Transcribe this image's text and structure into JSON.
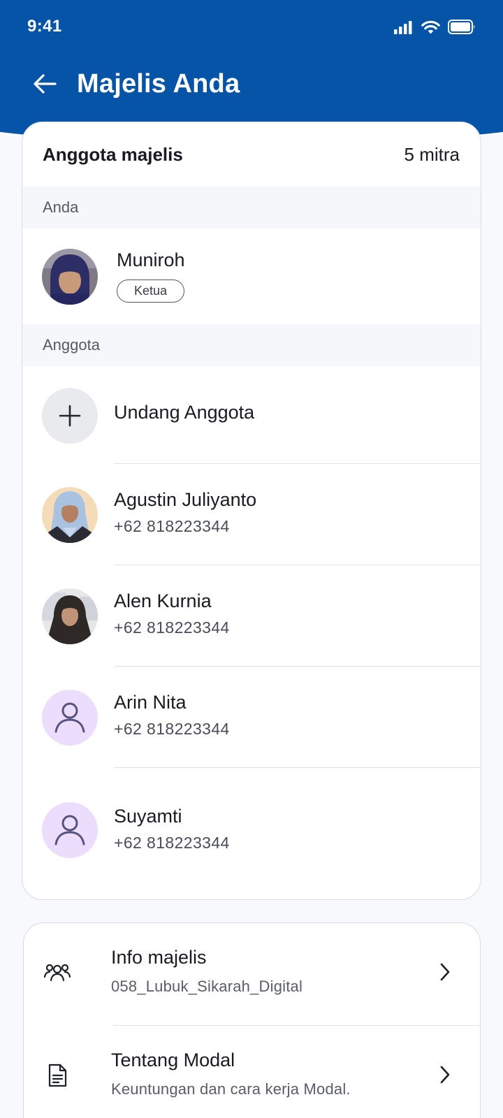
{
  "status_bar": {
    "time": "9:41"
  },
  "app_bar": {
    "title": "Majelis Anda"
  },
  "members": {
    "title": "Anggota majelis",
    "count": "5 mitra",
    "self_section_label": "Anda",
    "self": {
      "name": "Muniroh",
      "role": "Ketua"
    },
    "members_section_label": "Anggota",
    "invite_label": "Undang Anggota",
    "list": [
      {
        "name": "Agustin Juliyanto",
        "phone": "+62 818223344"
      },
      {
        "name": "Alen Kurnia",
        "phone": "+62 818223344"
      },
      {
        "name": "Arin Nita",
        "phone": "+62 818223344"
      },
      {
        "name": "Suyamti",
        "phone": "+62 818223344"
      }
    ]
  },
  "info": {
    "items": [
      {
        "title": "Info majelis",
        "subtitle": "058_Lubuk_Sikarah_Digital"
      },
      {
        "title": "Tentang Modal",
        "subtitle": "Keuntungan dan cara kerja Modal."
      }
    ]
  },
  "colors": {
    "header_blue": "#0654a8",
    "placeholder_avatar_bg": "#ebddfb",
    "placeholder_avatar_icon": "#55527d"
  }
}
